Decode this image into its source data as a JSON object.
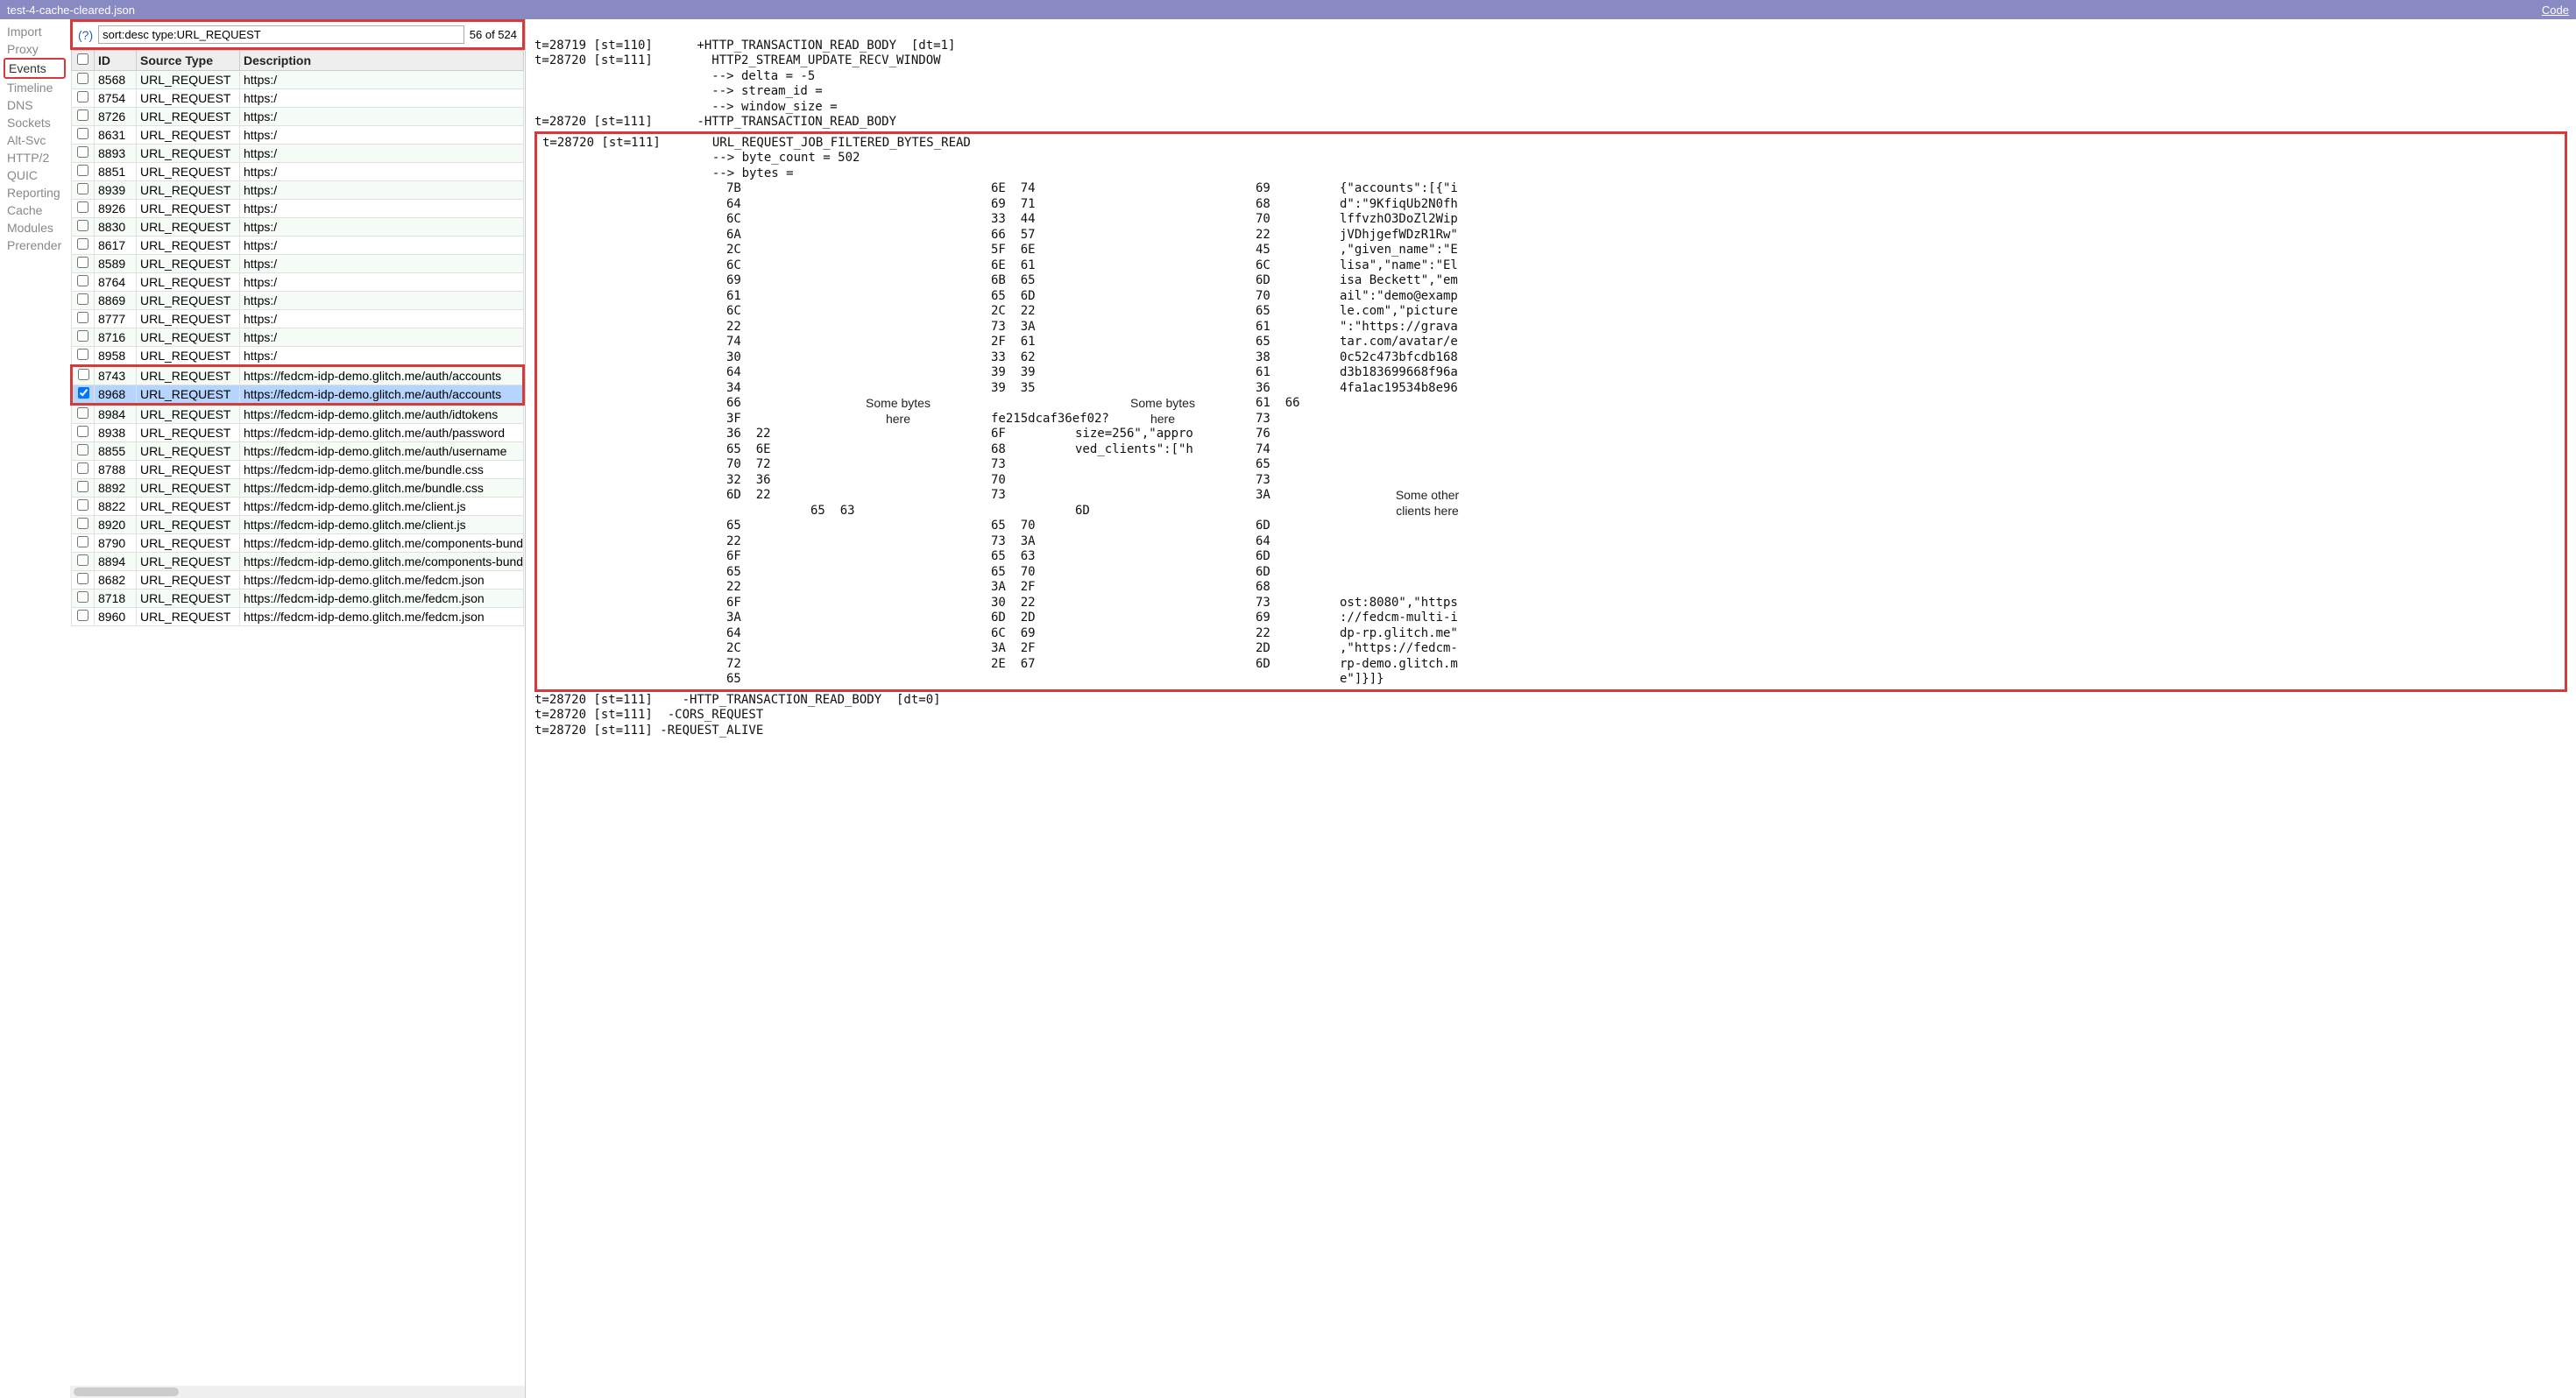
{
  "topbar": {
    "title": "test-4-cache-cleared.json",
    "code_link": "Code"
  },
  "sidebar": {
    "items": [
      {
        "label": "Import"
      },
      {
        "label": "Proxy"
      },
      {
        "label": "Events",
        "selected": true
      },
      {
        "label": "Timeline"
      },
      {
        "label": "DNS"
      },
      {
        "label": "Sockets"
      },
      {
        "label": "Alt-Svc"
      },
      {
        "label": "HTTP/2"
      },
      {
        "label": "QUIC"
      },
      {
        "label": "Reporting"
      },
      {
        "label": "Cache"
      },
      {
        "label": "Modules"
      },
      {
        "label": "Prerender"
      }
    ]
  },
  "filter": {
    "help": "(?)",
    "value": "sort:desc type:URL_REQUEST",
    "count": "56 of 524"
  },
  "table": {
    "headers": {
      "id": "ID",
      "source": "Source Type",
      "desc": "Description"
    },
    "rows": [
      {
        "id": "8568",
        "src": "URL_REQUEST",
        "desc": "https:/"
      },
      {
        "id": "8754",
        "src": "URL_REQUEST",
        "desc": "https:/"
      },
      {
        "id": "8726",
        "src": "URL_REQUEST",
        "desc": "https:/"
      },
      {
        "id": "8631",
        "src": "URL_REQUEST",
        "desc": "https:/"
      },
      {
        "id": "8893",
        "src": "URL_REQUEST",
        "desc": "https:/"
      },
      {
        "id": "8851",
        "src": "URL_REQUEST",
        "desc": "https:/"
      },
      {
        "id": "8939",
        "src": "URL_REQUEST",
        "desc": "https:/"
      },
      {
        "id": "8926",
        "src": "URL_REQUEST",
        "desc": "https:/"
      },
      {
        "id": "8830",
        "src": "URL_REQUEST",
        "desc": "https:/"
      },
      {
        "id": "8617",
        "src": "URL_REQUEST",
        "desc": "https:/"
      },
      {
        "id": "8589",
        "src": "URL_REQUEST",
        "desc": "https:/"
      },
      {
        "id": "8764",
        "src": "URL_REQUEST",
        "desc": "https:/"
      },
      {
        "id": "8869",
        "src": "URL_REQUEST",
        "desc": "https:/"
      },
      {
        "id": "8777",
        "src": "URL_REQUEST",
        "desc": "https:/"
      },
      {
        "id": "8716",
        "src": "URL_REQUEST",
        "desc": "https:/"
      },
      {
        "id": "8958",
        "src": "URL_REQUEST",
        "desc": "https:/"
      },
      {
        "id": "8743",
        "src": "URL_REQUEST",
        "desc": "https://fedcm-idp-demo.glitch.me/auth/accounts",
        "boxed": true
      },
      {
        "id": "8968",
        "src": "URL_REQUEST",
        "desc": "https://fedcm-idp-demo.glitch.me/auth/accounts",
        "boxed": true,
        "checked": true,
        "selected": true
      },
      {
        "id": "8984",
        "src": "URL_REQUEST",
        "desc": "https://fedcm-idp-demo.glitch.me/auth/idtokens"
      },
      {
        "id": "8938",
        "src": "URL_REQUEST",
        "desc": "https://fedcm-idp-demo.glitch.me/auth/password"
      },
      {
        "id": "8855",
        "src": "URL_REQUEST",
        "desc": "https://fedcm-idp-demo.glitch.me/auth/username"
      },
      {
        "id": "8788",
        "src": "URL_REQUEST",
        "desc": "https://fedcm-idp-demo.glitch.me/bundle.css"
      },
      {
        "id": "8892",
        "src": "URL_REQUEST",
        "desc": "https://fedcm-idp-demo.glitch.me/bundle.css"
      },
      {
        "id": "8822",
        "src": "URL_REQUEST",
        "desc": "https://fedcm-idp-demo.glitch.me/client.js"
      },
      {
        "id": "8920",
        "src": "URL_REQUEST",
        "desc": "https://fedcm-idp-demo.glitch.me/client.js"
      },
      {
        "id": "8790",
        "src": "URL_REQUEST",
        "desc": "https://fedcm-idp-demo.glitch.me/components-bundle.j"
      },
      {
        "id": "8894",
        "src": "URL_REQUEST",
        "desc": "https://fedcm-idp-demo.glitch.me/components-bundle.j"
      },
      {
        "id": "8682",
        "src": "URL_REQUEST",
        "desc": "https://fedcm-idp-demo.glitch.me/fedcm.json"
      },
      {
        "id": "8718",
        "src": "URL_REQUEST",
        "desc": "https://fedcm-idp-demo.glitch.me/fedcm.json"
      },
      {
        "id": "8960",
        "src": "URL_REQUEST",
        "desc": "https://fedcm-idp-demo.glitch.me/fedcm.json"
      }
    ]
  },
  "detail": {
    "pre_lines": [
      "t=28719 [st=110]      +HTTP_TRANSACTION_READ_BODY  [dt=1]",
      "t=28720 [st=111]        HTTP2_STREAM_UPDATE_RECV_WINDOW",
      "                        --> delta = -5",
      "                        --> stream_id =",
      "                        --> window_size =",
      "t=28720 [st=111]      -HTTP_TRANSACTION_READ_BODY"
    ],
    "box_header": [
      "t=28720 [st=111]       URL_REQUEST_JOB_FILTERED_BYTES_READ",
      "                       --> byte_count = 502",
      "                       --> bytes ="
    ],
    "hex_rows": [
      {
        "c1": "7B",
        "c2": "6E  74",
        "c3": "69",
        "txt": "{\"accounts\":[{\"i"
      },
      {
        "c1": "64",
        "c2": "69  71",
        "c3": "68",
        "txt": "d\":\"9KfiqUb2N0fh"
      },
      {
        "c1": "6C",
        "c2": "33  44",
        "c3": "70",
        "txt": "lffvzhO3DoZl2Wip"
      },
      {
        "c1": "6A",
        "c2": "66  57",
        "c3": "22",
        "txt": "jVDhjgefWDzR1Rw\""
      },
      {
        "c1": "2C",
        "c2": "5F  6E",
        "c3": "45",
        "txt": ",\"given_name\":\"E"
      },
      {
        "c1": "6C",
        "c2": "6E  61",
        "c3": "6C",
        "txt": "lisa\",\"name\":\"El"
      },
      {
        "c1": "69",
        "c2": "6B  65",
        "c3": "6D",
        "txt": "isa Beckett\",\"em"
      },
      {
        "c1": "61",
        "c2": "65  6D",
        "c3": "70",
        "txt": "ail\":\"demo@examp"
      },
      {
        "c1": "6C",
        "c2": "2C  22",
        "c3": "65",
        "txt": "le.com\",\"picture"
      },
      {
        "c1": "22",
        "c2": "73  3A",
        "c3": "61",
        "txt": "\":\"https://grava"
      },
      {
        "c1": "74",
        "c2": "2F  61",
        "c3": "65",
        "txt": "tar.com/avatar/e"
      },
      {
        "c1": "30",
        "c2": "33  62",
        "c3": "38",
        "txt": "0c52c473bfcdb168"
      },
      {
        "c1": "64",
        "c2": "39  39",
        "c3": "61",
        "txt": "d3b183699668f96a"
      },
      {
        "c1": "34",
        "c2": "39  35",
        "c3": "36",
        "txt": "4fa1ac19534b8e96"
      },
      {
        "c1": "66",
        "c2": "61  66",
        "c3": "3F",
        "txt": "fe215dcaf36ef02?"
      },
      {
        "c1": "73",
        "c2": "36  22",
        "c3": "6F",
        "txt": "size=256\",\"appro"
      },
      {
        "c1": "76",
        "c2": "65  6E",
        "c3": "68",
        "txt": "ved_clients\":[\"h"
      },
      {
        "c1": "74",
        "c2": "70  72",
        "c3": "73",
        "txt": ""
      },
      {
        "c1": "65",
        "c2": "32  36",
        "c3": "70",
        "txt": ""
      },
      {
        "c1": "73",
        "c2": "6D  22",
        "c3": "73",
        "txt": ""
      },
      {
        "c1": "3A",
        "c2": "65  63",
        "c3": "6D",
        "txt": ""
      },
      {
        "c1": "65",
        "c2": "65  70",
        "c3": "6D",
        "txt": ""
      },
      {
        "c1": "22",
        "c2": "73  3A",
        "c3": "64",
        "txt": ""
      },
      {
        "c1": "6F",
        "c2": "65  63",
        "c3": "6D",
        "txt": ""
      },
      {
        "c1": "65",
        "c2": "65  70",
        "c3": "6D",
        "txt": ""
      },
      {
        "c1": "22",
        "c2": "3A  2F",
        "c3": "68",
        "txt": ""
      },
      {
        "c1": "6F",
        "c2": "30  22",
        "c3": "73",
        "txt": "ost:8080\",\"https"
      },
      {
        "c1": "3A",
        "c2": "6D  2D",
        "c3": "69",
        "txt": "://fedcm-multi-i"
      },
      {
        "c1": "64",
        "c2": "6C  69",
        "c3": "22",
        "txt": "dp-rp.glitch.me\""
      },
      {
        "c1": "2C",
        "c2": "3A  2F",
        "c3": "2D",
        "txt": ",\"https://fedcm-"
      },
      {
        "c1": "72",
        "c2": "2E  67",
        "c3": "6D",
        "txt": "rp-demo.glitch.m"
      },
      {
        "c1": "65",
        "c2": "",
        "c3": "",
        "txt": "e\"]}]}"
      }
    ],
    "note1": "Some bytes\nhere",
    "note2": "Some bytes\nhere",
    "note3": "Some other\nclients here",
    "post_lines": [
      "t=28720 [st=111]    -HTTP_TRANSACTION_READ_BODY  [dt=0]",
      "t=28720 [st=111]  -CORS_REQUEST",
      "t=28720 [st=111] -REQUEST_ALIVE"
    ]
  }
}
